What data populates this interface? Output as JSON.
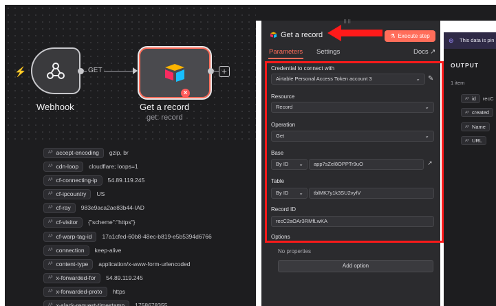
{
  "canvas": {
    "webhook_label": "Webhook",
    "airtable_label": "Get a record",
    "airtable_sub": "get: record",
    "connection_label": "GET"
  },
  "headers": [
    {
      "key": "accept-encoding",
      "value": "gzip, br"
    },
    {
      "key": "cdn-loop",
      "value": "cloudflare; loops=1"
    },
    {
      "key": "cf-connecting-ip",
      "value": "54.89.119.245"
    },
    {
      "key": "cf-ipcountry",
      "value": "US"
    },
    {
      "key": "cf-ray",
      "value": "983e9aca2ae83b44-IAD"
    },
    {
      "key": "cf-visitor",
      "value": "{\"scheme\":\"https\"}"
    },
    {
      "key": "cf-warp-tag-id",
      "value": "17a1cfed-60b8-48ec-b819-e5b5394d6766"
    },
    {
      "key": "connection",
      "value": "keep-alive"
    },
    {
      "key": "content-type",
      "value": "application/x-www-form-urlencoded"
    },
    {
      "key": "x-forwarded-for",
      "value": "54.89.119.245"
    },
    {
      "key": "x-forwarded-proto",
      "value": "https"
    },
    {
      "key": "x-slack-request-timestamp",
      "value": "1758678355"
    }
  ],
  "panel": {
    "title": "Get a record",
    "execute_label": "Execute step",
    "tab_parameters": "Parameters",
    "tab_settings": "Settings",
    "docs": "Docs",
    "credential_label": "Credential to connect with",
    "credential_value": "Airtable Personal Access Token account 3",
    "resource_label": "Resource",
    "resource_value": "Record",
    "operation_label": "Operation",
    "operation_value": "Get",
    "base_label": "Base",
    "base_mode": "By ID",
    "base_value": "app7sZel8OPPTr9uO",
    "table_label": "Table",
    "table_mode": "By ID",
    "table_value": "tblMK7y1k3SU2vyfV",
    "record_id_label": "Record ID",
    "record_id_value": "recC2aOAr3RMfLwKA",
    "options_label": "Options",
    "no_properties": "No properties",
    "add_option": "Add option"
  },
  "output": {
    "pinned_text": "This data is pin",
    "title": "OUTPUT",
    "count": "1 item",
    "rows": [
      {
        "key": "id",
        "value": "recC"
      },
      {
        "key": "created",
        "value": ""
      },
      {
        "key": "Name",
        "value": ""
      },
      {
        "key": "URL",
        "value": ""
      }
    ]
  },
  "colors": {
    "accent": "#ff6d5a",
    "annotation_red": "#ff1a1a",
    "canvas_bg": "#1d1d1f",
    "panel_bg": "#2b2b2e"
  }
}
